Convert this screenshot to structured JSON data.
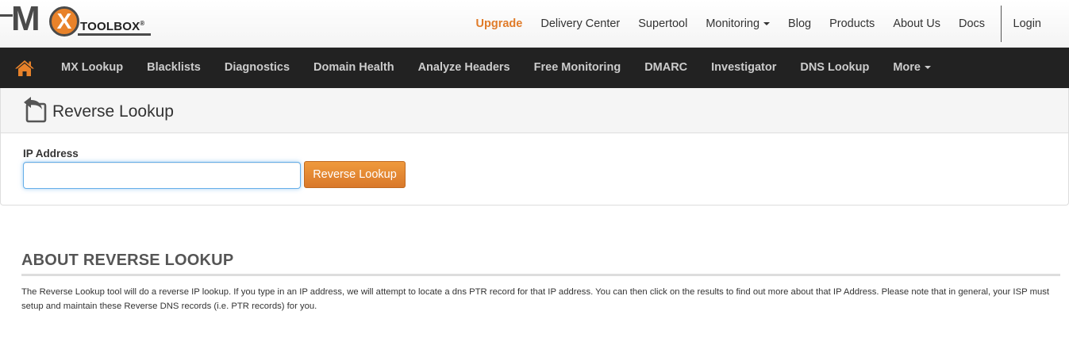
{
  "brand": {
    "logo_m": "M",
    "logo_x": "X",
    "logo_text": "TOOLBOX",
    "logo_reg": "®",
    "accent_color": "#e07b29",
    "navbar_color": "#222222"
  },
  "top_nav": {
    "items": [
      {
        "label": "Upgrade"
      },
      {
        "label": "Delivery Center"
      },
      {
        "label": "Supertool"
      },
      {
        "label": "Monitoring",
        "has_dropdown": true
      },
      {
        "label": "Blog"
      },
      {
        "label": "Products"
      },
      {
        "label": "About Us"
      },
      {
        "label": "Docs"
      }
    ],
    "login": "Login"
  },
  "main_nav": {
    "home_icon": "home-icon",
    "items": [
      {
        "label": "MX Lookup"
      },
      {
        "label": "Blacklists"
      },
      {
        "label": "Diagnostics"
      },
      {
        "label": "Domain Health"
      },
      {
        "label": "Analyze Headers"
      },
      {
        "label": "Free Monitoring"
      },
      {
        "label": "DMARC"
      },
      {
        "label": "Investigator"
      },
      {
        "label": "DNS Lookup"
      },
      {
        "label": "More",
        "has_dropdown": true
      }
    ]
  },
  "tool": {
    "icon": "reverse-arrow-icon",
    "title": "Reverse Lookup",
    "field_label": "IP Address",
    "input_value": "",
    "button_label": "Reverse Lookup"
  },
  "about": {
    "title": "ABOUT REVERSE LOOKUP",
    "text": "The Reverse Lookup tool will do a reverse IP lookup. If you type in an IP address, we will attempt to locate a dns PTR record for that IP address. You can then click on the results to find out more about that IP Address. Please note that in general, your ISP must setup and maintain these Reverse DNS records (i.e. PTR records) for you."
  }
}
